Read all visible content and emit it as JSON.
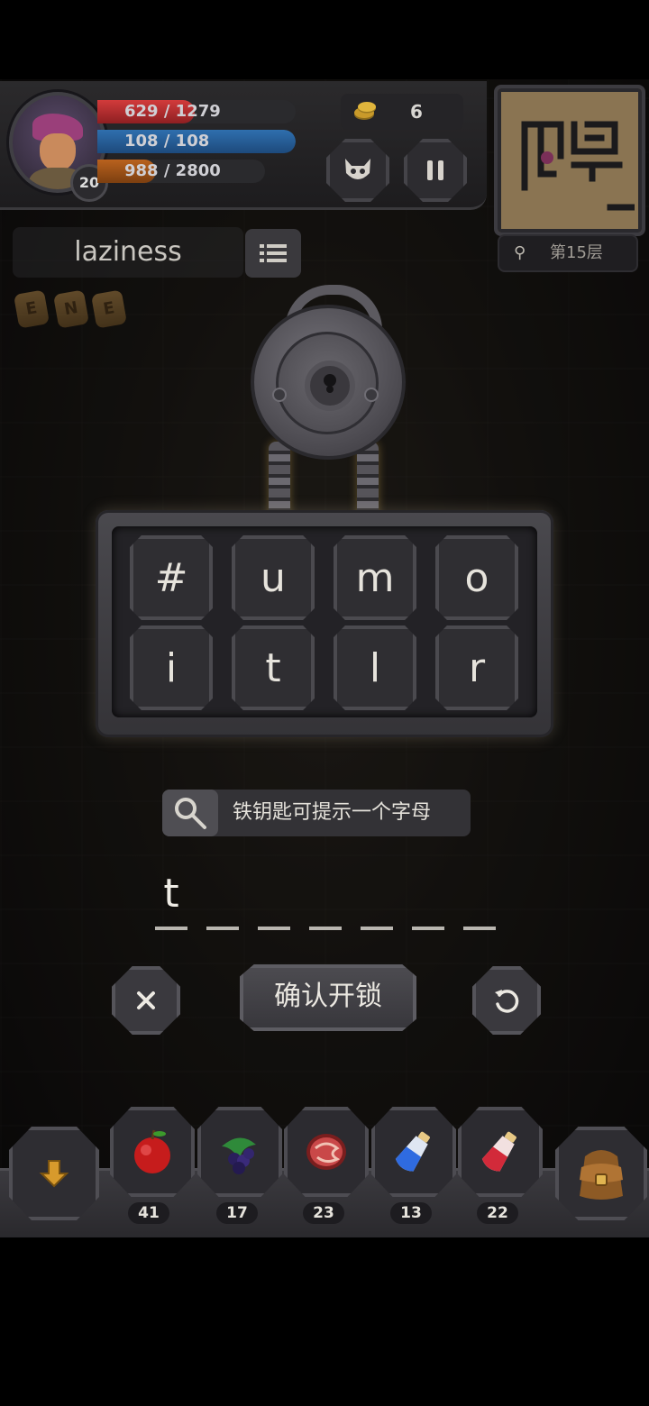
{
  "hud": {
    "hp": "629 / 1279",
    "hp_fraction": 0.49,
    "mp": "108 / 108",
    "mp_fraction": 1.0,
    "xp": "988 / 2800",
    "xp_fraction": 0.35,
    "level": "20",
    "gold": "6",
    "floor": "第15层"
  },
  "word": "laziness",
  "runes": [
    "E",
    "N",
    "E"
  ],
  "letters": [
    "#",
    "u",
    "m",
    "o",
    "i",
    "t",
    "l",
    "r"
  ],
  "hint_text": "铁钥匙可提示一个字母",
  "answer": {
    "letters": [
      "t",
      "",
      "",
      "",
      "",
      "",
      ""
    ]
  },
  "confirm_label": "确认开锁",
  "inventory": [
    {
      "name": "apple-icon",
      "count": "41"
    },
    {
      "name": "blackberry-icon",
      "count": "17"
    },
    {
      "name": "meat-icon",
      "count": "23"
    },
    {
      "name": "blue-potion-icon",
      "count": "13"
    },
    {
      "name": "red-potion-icon",
      "count": "22"
    }
  ],
  "colors": {
    "hp": "#d23b3b",
    "mp": "#2f6fae",
    "xp": "#b9621e",
    "panel": "#343337"
  }
}
